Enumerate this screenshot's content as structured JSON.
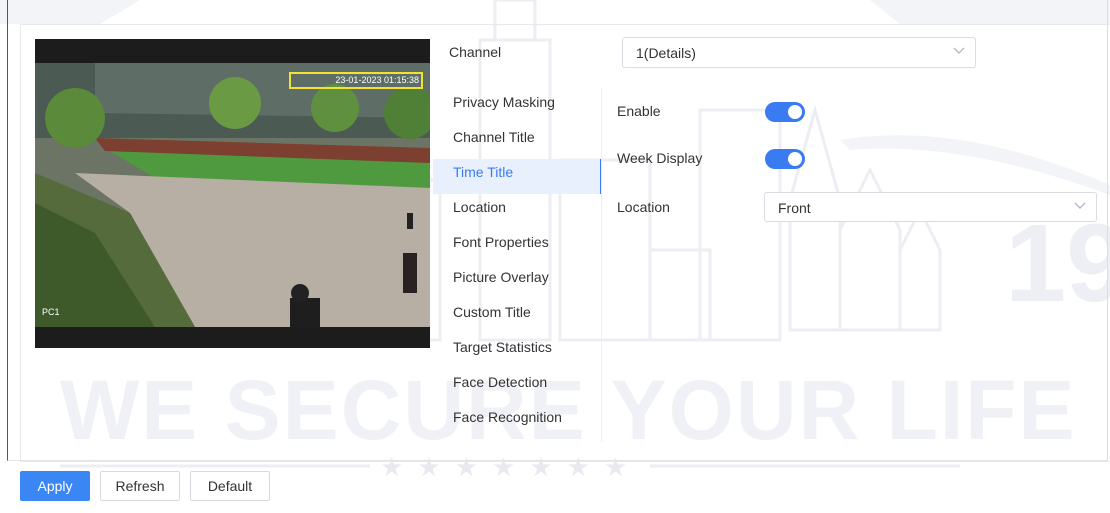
{
  "video": {
    "timestamp": "23-01-2023 01:15:38",
    "camera_label": "PC1"
  },
  "channel": {
    "label": "Channel",
    "value": "1(Details)"
  },
  "nav": {
    "items": [
      {
        "label": "Privacy Masking"
      },
      {
        "label": "Channel Title"
      },
      {
        "label": "Time Title"
      },
      {
        "label": "Location"
      },
      {
        "label": "Font Properties"
      },
      {
        "label": "Picture Overlay"
      },
      {
        "label": "Custom Title"
      },
      {
        "label": "Target Statistics"
      },
      {
        "label": "Face Detection"
      },
      {
        "label": "Face Recognition"
      }
    ],
    "active": "Time Title"
  },
  "form": {
    "enable_label": "Enable",
    "enable_on": true,
    "week_display_label": "Week Display",
    "week_display_on": true,
    "location_label": "Location",
    "location_value": "Front"
  },
  "buttons": {
    "apply": "Apply",
    "refresh": "Refresh",
    "default": "Default"
  },
  "watermark": {
    "slogan": "WE SECURE YOUR LIFE",
    "number": "19",
    "stars": "★★★★★★★"
  },
  "colors": {
    "accent": "#3b7bf1",
    "primary_button": "#3b86f5",
    "active_nav_bg": "#e8f0fe",
    "timestamp_box": "#f2e233"
  },
  "icons": {
    "select_chevron": "chevron-down-icon"
  }
}
